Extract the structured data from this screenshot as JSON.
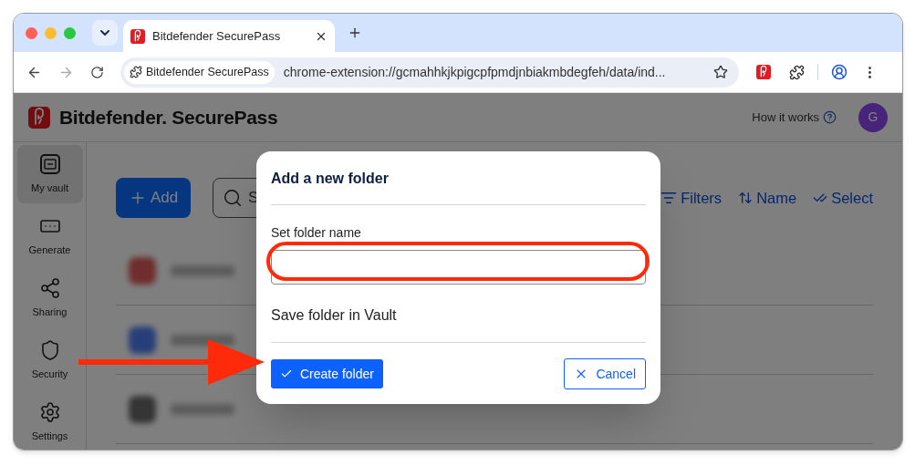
{
  "browser": {
    "tabs": [
      {
        "title": "Bitdefender SecurePass",
        "selected": true
      }
    ],
    "site_chip": "Bitdefender SecurePass",
    "url": "chrome-extension://gcmahhkjkpigcpfpmdjnbiakmbdegfeh/data/ind..."
  },
  "app": {
    "brand": "Bitdefender. SecurePass",
    "help_link": "How it works",
    "avatar": "G"
  },
  "sidebar": {
    "items": [
      {
        "label": "My vault",
        "kind": "vault",
        "selected": true
      },
      {
        "label": "Generate",
        "kind": "generate",
        "selected": false
      },
      {
        "label": "Sharing",
        "kind": "share",
        "selected": false
      },
      {
        "label": "Security",
        "kind": "shield",
        "selected": false
      },
      {
        "label": "Settings",
        "kind": "gear",
        "selected": false
      }
    ]
  },
  "toolbar": {
    "add_button": "Add",
    "search_placeholder": "S",
    "actions": [
      {
        "label": "Filters",
        "kind": "filter"
      },
      {
        "label": "Name",
        "kind": "sort"
      },
      {
        "label": "Select",
        "kind": "check"
      }
    ]
  },
  "dialog": {
    "title": "Add a new folder",
    "field_label": "Set folder name",
    "location": "Save folder in Vault",
    "primary_button": "Create folder",
    "secondary_button": "Cancel"
  }
}
